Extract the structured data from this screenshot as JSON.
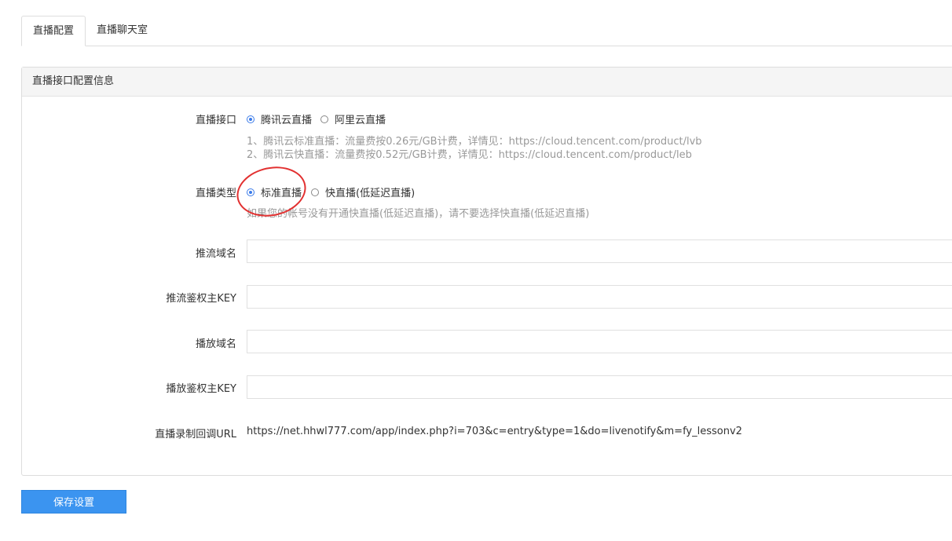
{
  "tabs": [
    {
      "label": "直播配置",
      "active": true
    },
    {
      "label": "直播聊天室",
      "active": false
    }
  ],
  "panel": {
    "title": "直播接口配置信息",
    "interface": {
      "label": "直播接口",
      "options": [
        "腾讯云直播",
        "阿里云直播"
      ],
      "selected": "腾讯云直播",
      "help": [
        "1、腾讯云标准直播：流量费按0.26元/GB计费，详情见：https://cloud.tencent.com/product/lvb",
        "2、腾讯云快直播：流量费按0.52元/GB计费，详情见：https://cloud.tencent.com/product/leb"
      ]
    },
    "type": {
      "label": "直播类型",
      "options": [
        "标准直播",
        "快直播(低延迟直播)"
      ],
      "selected": "标准直播",
      "help": "如果您的帐号没有开通快直播(低延迟直播)，请不要选择快直播(低延迟直播)"
    },
    "push_domain": {
      "label": "推流域名",
      "value": ""
    },
    "push_key": {
      "label": "推流鉴权主KEY",
      "value": ""
    },
    "play_domain": {
      "label": "播放域名",
      "value": ""
    },
    "play_key": {
      "label": "播放鉴权主KEY",
      "value": ""
    },
    "callback": {
      "label": "直播录制回调URL",
      "value": "https://net.hhwl777.com/app/index.php?i=703&c=entry&type=1&do=livenotify&m=fy_lessonv2"
    }
  },
  "save_label": "保存设置",
  "colors": {
    "accent": "#3b94f0",
    "annotation": "#e23030"
  }
}
